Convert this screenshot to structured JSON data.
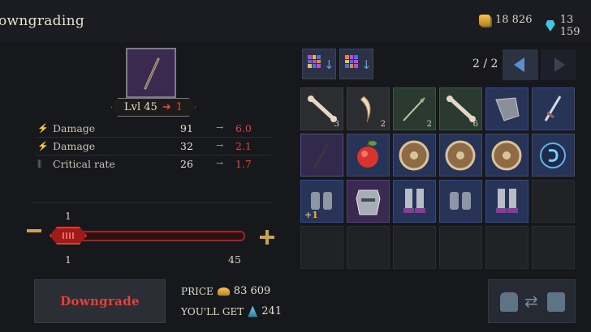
{
  "header": {
    "title": "owngrading",
    "gold": "18 826",
    "gems": "13 159"
  },
  "item": {
    "level_label": "Lvl 45",
    "level_target": "1"
  },
  "stats": [
    {
      "icon": "sword-icon",
      "name": "Damage",
      "current": "91",
      "new": "6.0"
    },
    {
      "icon": "sword-icon",
      "name": "Damage",
      "current": "32",
      "new": "2.1"
    },
    {
      "icon": "claw-icon",
      "name": "Critical rate",
      "current": "26",
      "new": "1.7"
    }
  ],
  "slider": {
    "value": 1,
    "value_label": "1",
    "min_label": "1",
    "max_label": "45",
    "fraction": 0.0
  },
  "actions": {
    "downgrade_label": "Downgrade",
    "price_label": "PRICE",
    "price_value": "83 609",
    "gain_label": "YOU'LL GET",
    "gain_value": "241"
  },
  "inventory": {
    "page": "2 / 2",
    "cells": [
      {
        "item": "bone-icon",
        "rarity": "common",
        "qty": "3"
      },
      {
        "item": "fang-icon",
        "rarity": "common",
        "qty": "2"
      },
      {
        "item": "arrow-icon",
        "rarity": "uncommon",
        "qty": "2"
      },
      {
        "item": "bone-icon",
        "rarity": "uncommon",
        "qty": "6"
      },
      {
        "item": "pauldron-icon",
        "rarity": "rare",
        "qty": ""
      },
      {
        "item": "dagger-icon",
        "rarity": "rare",
        "qty": ""
      },
      {
        "item": "staff-icon",
        "rarity": "epic-hl",
        "qty": ""
      },
      {
        "item": "apple-icon",
        "rarity": "rare",
        "qty": ""
      },
      {
        "item": "shield-icon",
        "rarity": "rare",
        "qty": ""
      },
      {
        "item": "shield-icon",
        "rarity": "rare",
        "qty": ""
      },
      {
        "item": "shield-icon",
        "rarity": "rare",
        "qty": ""
      },
      {
        "item": "rune-icon",
        "rarity": "rare",
        "qty": ""
      },
      {
        "item": "gauntlets-icon",
        "rarity": "rare",
        "qty": "",
        "bonus": "+1"
      },
      {
        "item": "chestplate-icon",
        "rarity": "epic",
        "qty": ""
      },
      {
        "item": "boots-icon",
        "rarity": "rare",
        "qty": ""
      },
      {
        "item": "gauntlets-icon",
        "rarity": "rare",
        "qty": ""
      },
      {
        "item": "boots-icon",
        "rarity": "rare",
        "qty": ""
      },
      {
        "item": "",
        "rarity": "empty",
        "qty": ""
      }
    ]
  },
  "colors": {
    "accent_red": "#e0443e",
    "gold": "#c9a44c",
    "rare": "#283358",
    "epic": "#3a2a52"
  }
}
